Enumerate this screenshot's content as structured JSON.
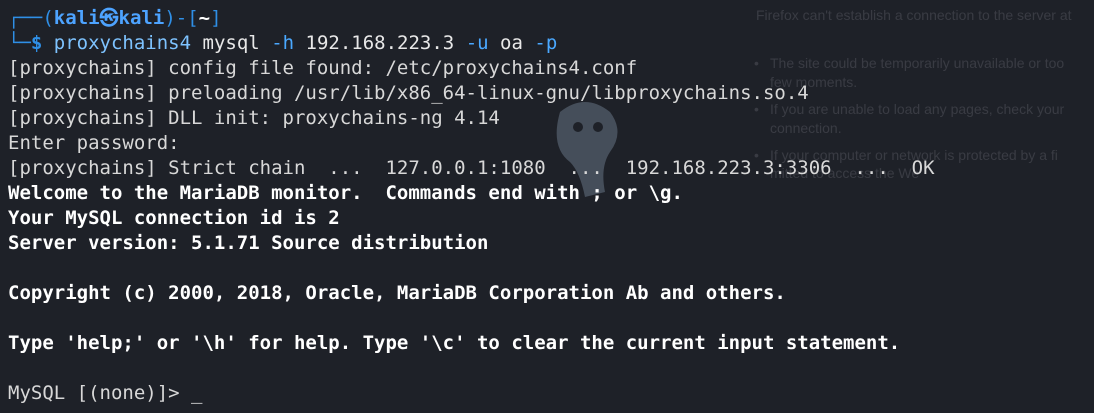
{
  "background_window": {
    "title": "Firefox can't establish a connection to the server at",
    "items": [
      "The site could be temporarily unavailable or too",
      "few moments.",
      "If you are unable to load any pages, check your",
      "connection.",
      "If your computer or network is protected by a fi",
      "mitted to access the We"
    ]
  },
  "prompt": {
    "corner_top": "┌──(",
    "user": "kali",
    "at_symbol": "㉿",
    "host": "kali",
    "mid": ")-[",
    "dir": "~",
    "close": "]",
    "corner_bottom": "└─",
    "dollar": "$"
  },
  "command": {
    "program": "proxychains4",
    "sub": "mysql",
    "flag_host": "-h",
    "host": "192.168.223.3",
    "flag_user": "-u",
    "user": "oa",
    "flag_pass": "-p"
  },
  "output": [
    "[proxychains] config file found: /etc/proxychains4.conf",
    "[proxychains] preloading /usr/lib/x86_64-linux-gnu/libproxychains.so.4",
    "[proxychains] DLL init: proxychains-ng 4.14",
    "Enter password:",
    "[proxychains] Strict chain  ...  127.0.0.1:1080  ...  192.168.223.3:3306  ...  OK"
  ],
  "mysql_banner": [
    "Welcome to the MariaDB monitor.  Commands end with ; or \\g.",
    "Your MySQL connection id is 2",
    "Server version: 5.1.71 Source distribution",
    "",
    "Copyright (c) 2000, 2018, Oracle, MariaDB Corporation Ab and others.",
    "",
    "Type 'help;' or '\\h' for help. Type '\\c' to clear the current input statement.",
    ""
  ],
  "mysql_prompt": "MySQL [(none)]> ",
  "cursor": "_"
}
